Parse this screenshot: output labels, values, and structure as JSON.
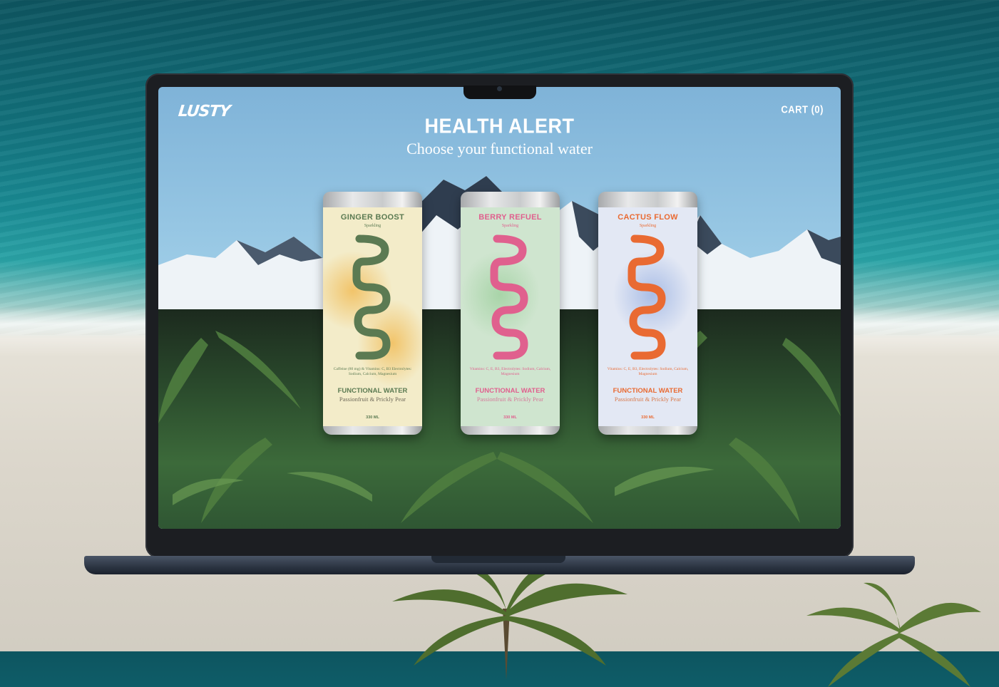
{
  "site": {
    "logo": "LUSTY",
    "cart_label": "CART (0)",
    "headline": "HEALTH ALERT",
    "subheadline": "Choose your functional water"
  },
  "products": [
    {
      "name": "GINGER BOOST",
      "variant": "Sparkling",
      "info": "Caffeine (80 mg) & Vitamins: C, B3 Electrolytes: Sodium, Calcium, Magnesium",
      "category": "FUNCTIONAL WATER",
      "flavor": "Passionfruit & Prickly Pear",
      "volume": "330 ML",
      "accent_color": "#5b7a52",
      "flavor_color": "#6f6a5a",
      "body_color": "#f3ecc9",
      "glow_color": "#f2c46a"
    },
    {
      "name": "BERRY REFUEL",
      "variant": "Sparkling",
      "info": "Vitamins: C, E, B3, Electrolytes: Sodium, Calcium, Magnesium",
      "category": "FUNCTIONAL WATER",
      "flavor": "Passionfruit & Prickly Pear",
      "volume": "330 ML",
      "accent_color": "#e0608e",
      "flavor_color": "#d57c9b",
      "body_color": "#cfe5cf",
      "glow_color": "#a8d4a8"
    },
    {
      "name": "CACTUS FLOW",
      "variant": "Sparkling",
      "info": "Vitamins: C, E, B3, Electrolytes: Sodium, Calcium, Magnesium",
      "category": "FUNCTIONAL WATER",
      "flavor": "Passionfruit & Prickly Pear",
      "volume": "330 ML",
      "accent_color": "#e96a32",
      "flavor_color": "#d8794b",
      "body_color": "#e3e8f4",
      "glow_color": "#a9bde6"
    }
  ],
  "icons": {
    "camera": "camera-icon",
    "logo_mark": "lusty-wordmark-icon"
  }
}
